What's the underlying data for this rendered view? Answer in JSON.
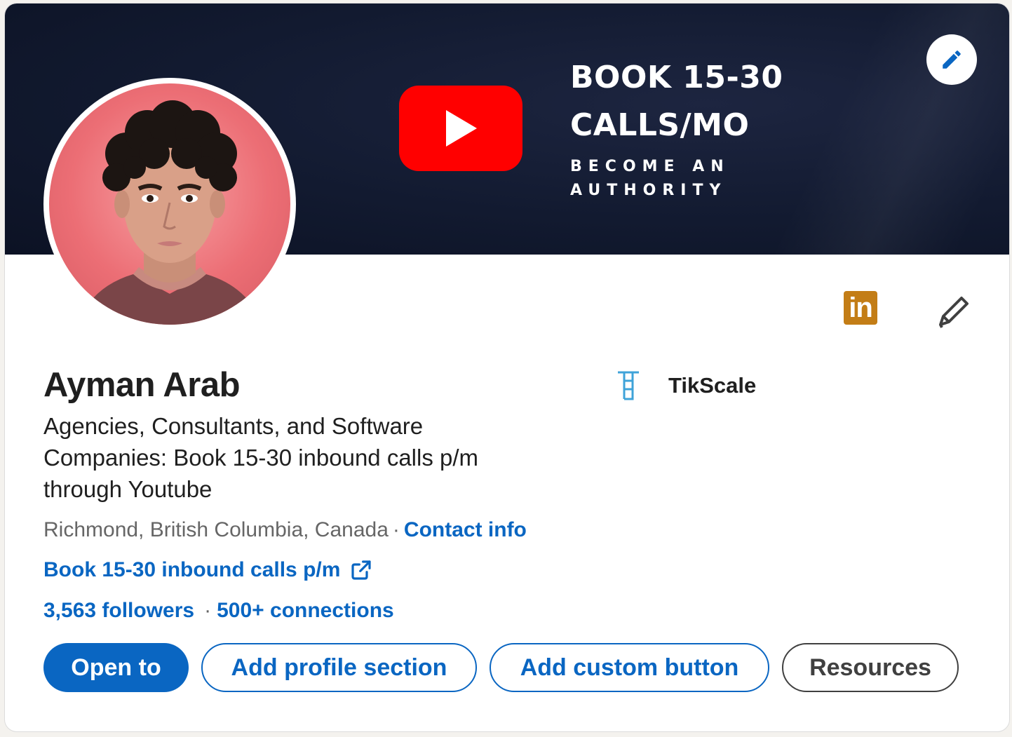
{
  "banner": {
    "headline_line1": "BOOK 15-30",
    "headline_line2": "CALLS/MO",
    "sub_line1": "BECOME AN",
    "sub_line2": "AUTHORITY",
    "background_color": "#121a30",
    "logo_icon": "youtube-play-icon",
    "edit_icon": "pencil-icon"
  },
  "profile": {
    "name": "Ayman Arab",
    "headline": "Agencies, Consultants, and Software Companies: Book 15-30 inbound calls p/m through Youtube",
    "location": "Richmond, British Columbia, Canada",
    "separator": "·",
    "contact_info": "Contact info",
    "website": "Book 15-30 inbound calls p/m",
    "followers": "3,563 followers",
    "connections": "500+ connections"
  },
  "company": {
    "name": "TikScale",
    "logo_icon": "tikscale-logo-icon"
  },
  "badges": {
    "linkedin": "in",
    "edit_icon": "pencil-icon"
  },
  "actions": {
    "open_to": "Open to",
    "add_profile_section": "Add profile section",
    "add_custom_button": "Add custom button",
    "resources": "Resources"
  },
  "colors": {
    "accent": "#0a66c2",
    "youtube_red": "#ff0000",
    "premium_gold": "#c37d16",
    "text_primary": "#1f1f1f",
    "text_secondary": "#666666"
  }
}
